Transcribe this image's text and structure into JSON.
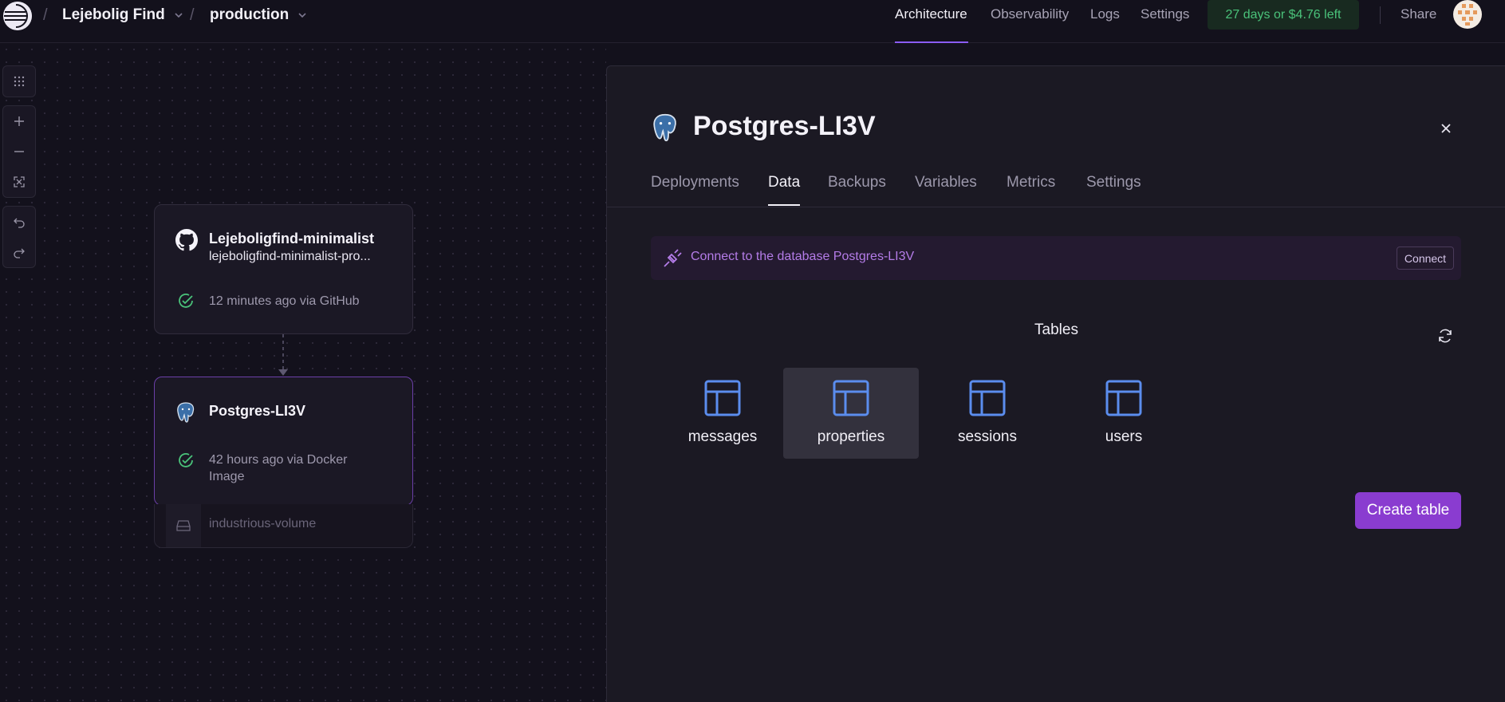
{
  "breadcrumb": {
    "project": "Lejebolig Find",
    "environment": "production"
  },
  "nav": {
    "architecture": "Architecture",
    "observability": "Observability",
    "logs": "Logs",
    "settings": "Settings",
    "trial": "27 days or $4.76 left",
    "share": "Share"
  },
  "colors": {
    "accent": "#8b5cf6",
    "primary_button": "#8a3cd0",
    "success": "#4ac27a",
    "table_icon": "#5b8dee"
  },
  "canvas": {
    "tools": [
      "grid-icon",
      "zoom-in-icon",
      "zoom-out-icon",
      "fit-view-icon",
      "undo-icon",
      "redo-icon"
    ],
    "service": {
      "title": "Lejeboligfind-minimalist",
      "subtitle": "lejeboligfind-minimalist-pro...",
      "status": "12 minutes ago via GitHub",
      "icon": "github-icon"
    },
    "database": {
      "title": "Postgres-LI3V",
      "status_line1": "42 hours ago via Docker",
      "status_line2": "Image",
      "icon": "postgres-icon"
    },
    "volume": {
      "name": "industrious-volume",
      "icon": "disk-icon"
    }
  },
  "panel": {
    "title": "Postgres-LI3V",
    "tabs": [
      "Deployments",
      "Data",
      "Backups",
      "Variables",
      "Metrics",
      "Settings"
    ],
    "active_tab": "Data",
    "connect": {
      "text": "Connect to the database Postgres-LI3V",
      "button": "Connect"
    },
    "tables_heading": "Tables",
    "tables": [
      "messages",
      "properties",
      "sessions",
      "users"
    ],
    "selected_table": "properties",
    "create_button": "Create table"
  }
}
